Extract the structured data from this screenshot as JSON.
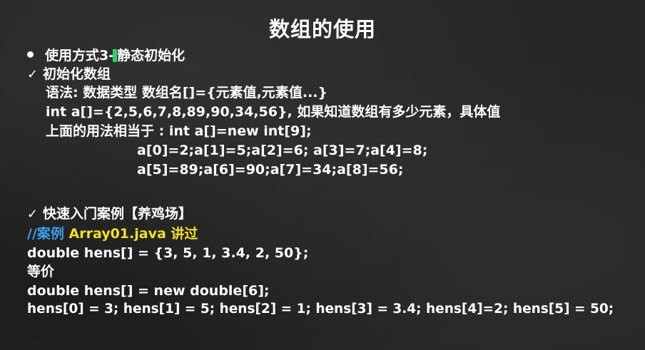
{
  "title": "数组的使用",
  "section1": {
    "bullet_text_a": "使用方式3-",
    "bullet_text_b": "静态初始化"
  },
  "section2": {
    "heading": "初始化数组",
    "syntax": "语法: 数据类型 数组名[]={元素值,元素值...}",
    "example": "int a[]={2,5,6,7,8,89,90,34,56}, 如果知道数组有多少元素，具体值",
    "equivalent": "上面的用法相当于 : int a[]=new int[9];",
    "assign_line1": "a[0]=2;a[1]=5;a[2]=6; a[3]=7;a[4]=8;",
    "assign_line2": "a[5]=89;a[6]=90;a[7]=34;a[8]=56;"
  },
  "section3": {
    "heading": "快速入门案例【养鸡场】",
    "comment_prefix": "//案例",
    "comment_file": "Array01.java 讲过",
    "code1": "double hens[] = {3, 5, 1, 3.4, 2, 50};",
    "equiv_label": "等价",
    "code2": "double hens[] = new double[6];",
    "code3": "hens[0] = 3; hens[1] = 5; hens[2] = 1; hens[3] = 3.4; hens[4]=2; hens[5] = 50;"
  },
  "icons": {
    "bullet": "bullet-dot-icon",
    "check": "checkmark-icon"
  },
  "colors": {
    "background": "#262626",
    "text": "#ffffff",
    "comment": "#3aa0e8",
    "highlight": "#f2e21c"
  }
}
